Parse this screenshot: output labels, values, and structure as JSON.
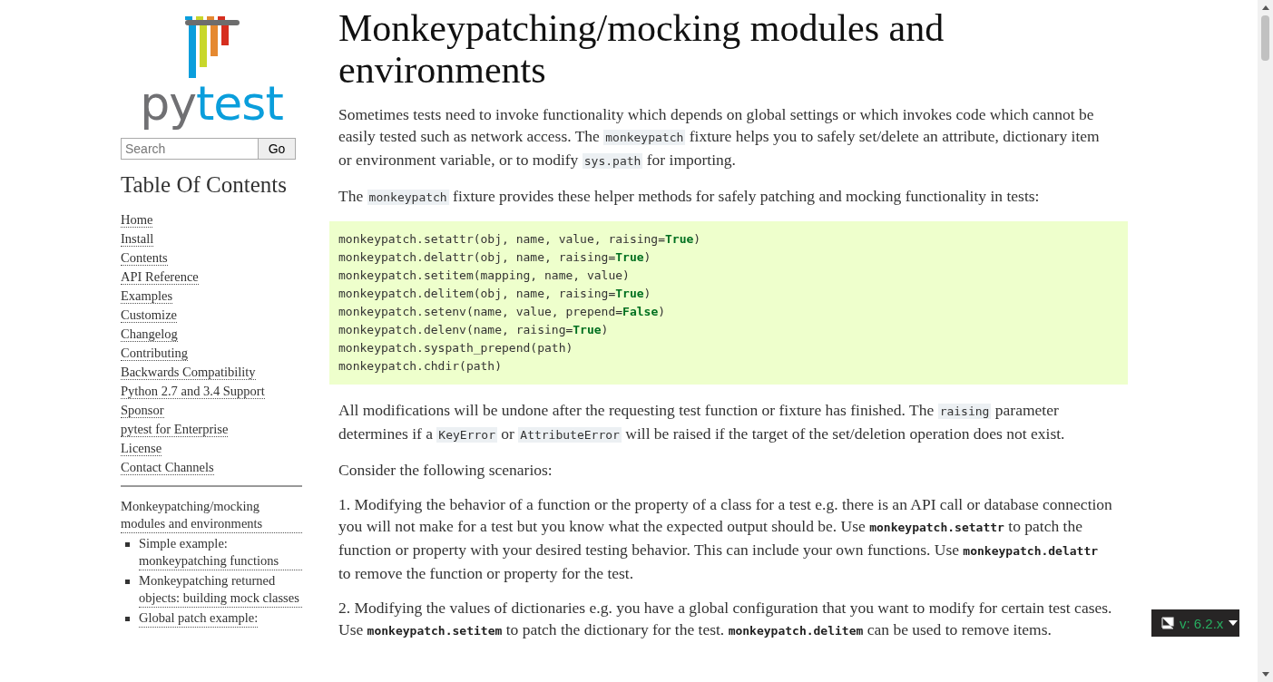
{
  "sidebar": {
    "logo": [
      {
        "text": "py",
        "kind": "grey"
      },
      {
        "text": "test",
        "kind": "blue"
      }
    ],
    "search": {
      "placeholder": "Search",
      "button": "Go"
    },
    "toc_title": "Table Of Contents",
    "links": [
      {
        "label": "Home"
      },
      {
        "label": "Install"
      },
      {
        "label": "Contents"
      },
      {
        "label": "API Reference"
      },
      {
        "label": "Examples"
      },
      {
        "label": "Customize"
      },
      {
        "label": "Changelog"
      },
      {
        "label": "Contributing"
      },
      {
        "label": "Backwards Compatibility"
      },
      {
        "label": "Python 2.7 and 3.4 Support"
      },
      {
        "label": "Sponsor"
      },
      {
        "label": "pytest for Enterprise"
      },
      {
        "label": "License"
      },
      {
        "label": "Contact Channels"
      }
    ],
    "local_toc": [
      {
        "label": "Monkeypatching/mocking modules and environments",
        "children": [
          {
            "label": "Simple example: monkeypatching functions"
          },
          {
            "label": "Monkeypatching returned objects: building mock classes"
          },
          {
            "label": "Global patch example:"
          }
        ]
      }
    ]
  },
  "main": {
    "title": "Monkeypatching/mocking modules and environments",
    "blocks": [
      {
        "kind": "para",
        "segments": [
          {
            "kind": "text",
            "text": "Sometimes tests need to invoke functionality which depends on global settings or which invokes code which cannot be easily tested such as network access. The "
          },
          {
            "kind": "code",
            "text": "monkeypatch"
          },
          {
            "kind": "text",
            "text": " fixture helps you to safely set/delete an attribute, dictionary item or environment variable, or to modify "
          },
          {
            "kind": "code",
            "text": "sys.path"
          },
          {
            "kind": "text",
            "text": " for importing."
          }
        ]
      },
      {
        "kind": "para",
        "segments": [
          {
            "kind": "text",
            "text": "The "
          },
          {
            "kind": "code",
            "text": "monkeypatch"
          },
          {
            "kind": "text",
            "text": " fixture provides these helper methods for safely patching and mocking functionality in tests:"
          }
        ]
      },
      {
        "kind": "codeblock",
        "lines": [
          [
            {
              "kind": "text",
              "text": "monkeypatch.setattr(obj, name, value, raising="
            },
            {
              "kind": "keyword",
              "text": "True"
            },
            {
              "kind": "text",
              "text": ")"
            }
          ],
          [
            {
              "kind": "text",
              "text": "monkeypatch.delattr(obj, name, raising="
            },
            {
              "kind": "keyword",
              "text": "True"
            },
            {
              "kind": "text",
              "text": ")"
            }
          ],
          [
            {
              "kind": "text",
              "text": "monkeypatch.setitem(mapping, name, value)"
            }
          ],
          [
            {
              "kind": "text",
              "text": "monkeypatch.delitem(obj, name, raising="
            },
            {
              "kind": "keyword",
              "text": "True"
            },
            {
              "kind": "text",
              "text": ")"
            }
          ],
          [
            {
              "kind": "text",
              "text": "monkeypatch.setenv(name, value, prepend="
            },
            {
              "kind": "keyword",
              "text": "False"
            },
            {
              "kind": "text",
              "text": ")"
            }
          ],
          [
            {
              "kind": "text",
              "text": "monkeypatch.delenv(name, raising="
            },
            {
              "kind": "keyword",
              "text": "True"
            },
            {
              "kind": "text",
              "text": ")"
            }
          ],
          [
            {
              "kind": "text",
              "text": "monkeypatch.syspath_prepend(path)"
            }
          ],
          [
            {
              "kind": "text",
              "text": "monkeypatch.chdir(path)"
            }
          ]
        ]
      },
      {
        "kind": "para",
        "segments": [
          {
            "kind": "text",
            "text": "All modifications will be undone after the requesting test function or fixture has finished. The "
          },
          {
            "kind": "code",
            "text": "raising"
          },
          {
            "kind": "text",
            "text": " parameter determines if a "
          },
          {
            "kind": "code",
            "text": "KeyError"
          },
          {
            "kind": "text",
            "text": " or "
          },
          {
            "kind": "code",
            "text": "AttributeError"
          },
          {
            "kind": "text",
            "text": " will be raised if the target of the set/deletion operation does not exist."
          }
        ]
      },
      {
        "kind": "para",
        "segments": [
          {
            "kind": "text",
            "text": "Consider the following scenarios:"
          }
        ]
      },
      {
        "kind": "para",
        "segments": [
          {
            "kind": "text",
            "text": "1. Modifying the behavior of a function or the property of a class for a test e.g. there is an API call or database connection you will not make for a test but you know what the expected output should be. Use "
          },
          {
            "kind": "strongcode",
            "text": "monkeypatch.setattr"
          },
          {
            "kind": "text",
            "text": " to patch the function or property with your desired testing behavior. This can include your own functions. Use "
          },
          {
            "kind": "strongcode",
            "text": "monkeypatch.delattr"
          },
          {
            "kind": "text",
            "text": " to remove the function or property for the test."
          }
        ]
      },
      {
        "kind": "para",
        "segments": [
          {
            "kind": "text",
            "text": "2. Modifying the values of dictionaries e.g. you have a global configuration that you want to modify for certain test cases. Use "
          },
          {
            "kind": "strongcode",
            "text": "monkeypatch.setitem"
          },
          {
            "kind": "text",
            "text": " to patch the dictionary for the test. "
          },
          {
            "kind": "strongcode",
            "text": "monkeypatch.delitem"
          },
          {
            "kind": "text",
            "text": " can be used to remove items."
          }
        ]
      }
    ]
  },
  "version_badge": {
    "label": "v: 6.2.x"
  }
}
